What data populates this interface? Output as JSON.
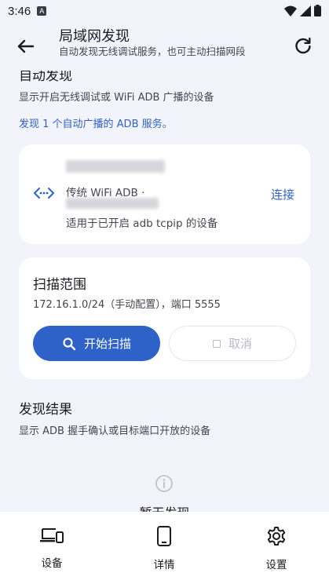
{
  "status_bar": {
    "time": "3:46",
    "notification_glyph": "A"
  },
  "appbar": {
    "title": "局域网发现",
    "subtitle": "自动发现无线调试服务，也可主动扫描网段"
  },
  "auto_discovery": {
    "title": "自动发现",
    "description": "显示开启无线调试或 WiFi ADB 广播的设备",
    "note": "发现 1 个自动广播的 ADB 服务。"
  },
  "device_card": {
    "type_label": "传统 WiFi ADB ·",
    "hint": "适用于已开启 adb tcpip 的设备",
    "connect_label": "连接"
  },
  "scan_card": {
    "title": "扫描范围",
    "range": "172.16.1.0/24（手动配置），端口 5555",
    "start_label": "开始扫描",
    "cancel_label": "取消"
  },
  "results": {
    "title": "发现结果",
    "description": "显示 ADB 握手确认或目标端口开放的设备",
    "empty_title": "暂无发现"
  },
  "bottom_nav": {
    "items": [
      {
        "label": "设备",
        "icon": "devices-icon"
      },
      {
        "label": "详情",
        "icon": "phone-icon"
      },
      {
        "label": "设置",
        "icon": "gear-icon"
      }
    ]
  },
  "colors": {
    "primary": "#2e62c8",
    "background": "#f3f3fb",
    "card": "#ffffff"
  }
}
